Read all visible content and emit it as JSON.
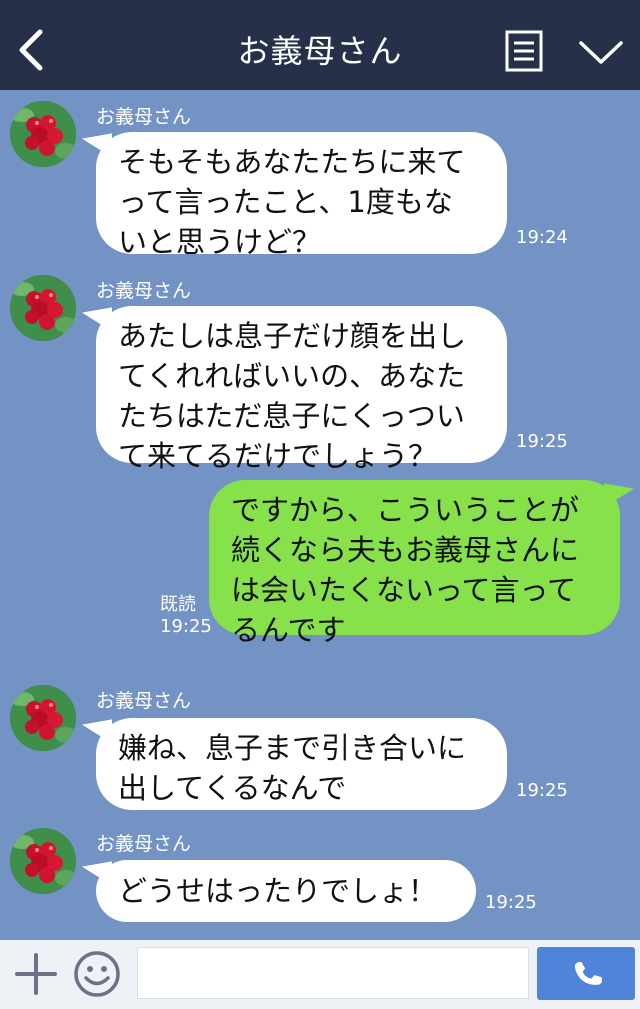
{
  "header": {
    "title": "お義母さん"
  },
  "messages": [
    {
      "side": "left",
      "sender": "お義母さん",
      "text": "そもそもあなたたちに来て\nって言ったこと、1度もな\nいと思うけど？",
      "time": "19:24"
    },
    {
      "side": "left",
      "sender": "お義母さん",
      "text": "あたしは息子だけ顔を出し\nてくれればいいの、あなた\nたちはただ息子にくっつい\nて来てるだけでしょう？",
      "time": "19:25"
    },
    {
      "side": "right",
      "text": "ですから、こういうことが\n続くなら夫もお義母さんに\nは会いたくないって言って\nるんです",
      "read": "既読",
      "time": "19:25"
    },
    {
      "side": "left",
      "sender": "お義母さん",
      "text": "嫌ね、息子まで引き合いに\n出してくるなんで",
      "time": "19:25"
    },
    {
      "side": "left",
      "sender": "お義母さん",
      "text": "どうせはったりでしょ！",
      "time": "19:25"
    }
  ],
  "input": {
    "value": "",
    "placeholder": ""
  },
  "icons": {
    "back": "back-icon",
    "menu": "menu-icon",
    "collapse": "chevron-down-icon",
    "add": "plus-icon",
    "emoji": "smile-icon",
    "call": "phone-icon"
  },
  "colors": {
    "header_bg": "#263049",
    "chat_bg": "#7393c4",
    "incoming_bubble": "#ffffff",
    "outgoing_bubble": "#86e14b",
    "call_button": "#4f84d8"
  }
}
